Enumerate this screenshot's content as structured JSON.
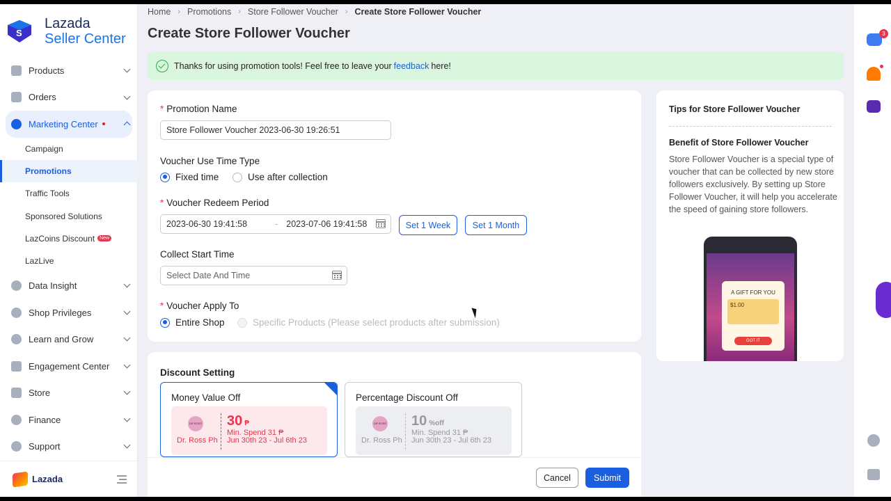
{
  "brand": {
    "name_line1": "Lazada",
    "name_line2": "Seller Center",
    "footer_name": "Lazada"
  },
  "sidebar": {
    "items": [
      {
        "label": "Products"
      },
      {
        "label": "Orders"
      },
      {
        "label": "Marketing Center"
      },
      {
        "label": "Data Insight"
      },
      {
        "label": "Shop Privileges"
      },
      {
        "label": "Learn and Grow"
      },
      {
        "label": "Engagement Center"
      },
      {
        "label": "Store"
      },
      {
        "label": "Finance"
      },
      {
        "label": "Support"
      }
    ],
    "marketing_sub": [
      {
        "label": "Campaign"
      },
      {
        "label": "Promotions"
      },
      {
        "label": "Traffic Tools"
      },
      {
        "label": "Sponsored Solutions"
      },
      {
        "label": "LazCoins Discount",
        "badge": "New"
      },
      {
        "label": "LazLive"
      }
    ]
  },
  "breadcrumb": [
    "Home",
    "Promotions",
    "Store Follower Voucher",
    "Create Store Follower Voucher"
  ],
  "page_title": "Create Store Follower Voucher",
  "notice": {
    "before": "Thanks for using promotion tools! Feel free to leave your",
    "link": "feedback",
    "after": "here!"
  },
  "form": {
    "promotion_name_label": "Promotion Name",
    "promotion_name_value": "Store Follower Voucher 2023-06-30 19:26:51",
    "use_time_type_label": "Voucher Use Time Type",
    "use_time_options": [
      "Fixed time",
      "Use after collection"
    ],
    "redeem_period_label": "Voucher Redeem Period",
    "redeem_start": "2023-06-30 19:41:58",
    "redeem_end": "2023-07-06 19:41:58",
    "set_week": "Set 1 Week",
    "set_month": "Set 1 Month",
    "collect_start_label": "Collect Start Time",
    "collect_start_placeholder": "Select Date And Time",
    "apply_to_label": "Voucher Apply To",
    "apply_options": [
      "Entire Shop",
      "Specific Products (Please select products after submission)"
    ]
  },
  "tips": {
    "title": "Tips for Store Follower Voucher",
    "subtitle": "Benefit of Store Follower Voucher",
    "body": "Store Follower Voucher is a special type of voucher that can be collected by new store followers exclusively. By setting up Store Follower Voucher, it will help you accelerate the speed of gaining store followers.",
    "preview": {
      "gift": "A GIFT FOR YOU",
      "amount": "$1.00",
      "got_it": "GOT IT"
    }
  },
  "discount": {
    "title": "Discount Setting",
    "cards": [
      {
        "title": "Money Value Off",
        "amount": "30",
        "unit": "₱",
        "shop": "Dr. Ross Ph",
        "min_spend": "Min. Spend 31 ₱",
        "dates": "Jun 30th 23 - Jul 6th 23"
      },
      {
        "title": "Percentage Discount Off",
        "amount": "10",
        "unit": "%off",
        "shop": "Dr. Ross Ph",
        "min_spend": "Min. Spend 31 ₱",
        "dates": "Jun 30th 23 - Jul 6th 23"
      }
    ]
  },
  "actions": {
    "cancel": "Cancel",
    "submit": "Submit"
  },
  "rail": {
    "chat_badge": "3"
  },
  "colors": {
    "primary": "#1a5fe0",
    "notice_bg": "#dbf6de",
    "required": "#e5354d"
  }
}
